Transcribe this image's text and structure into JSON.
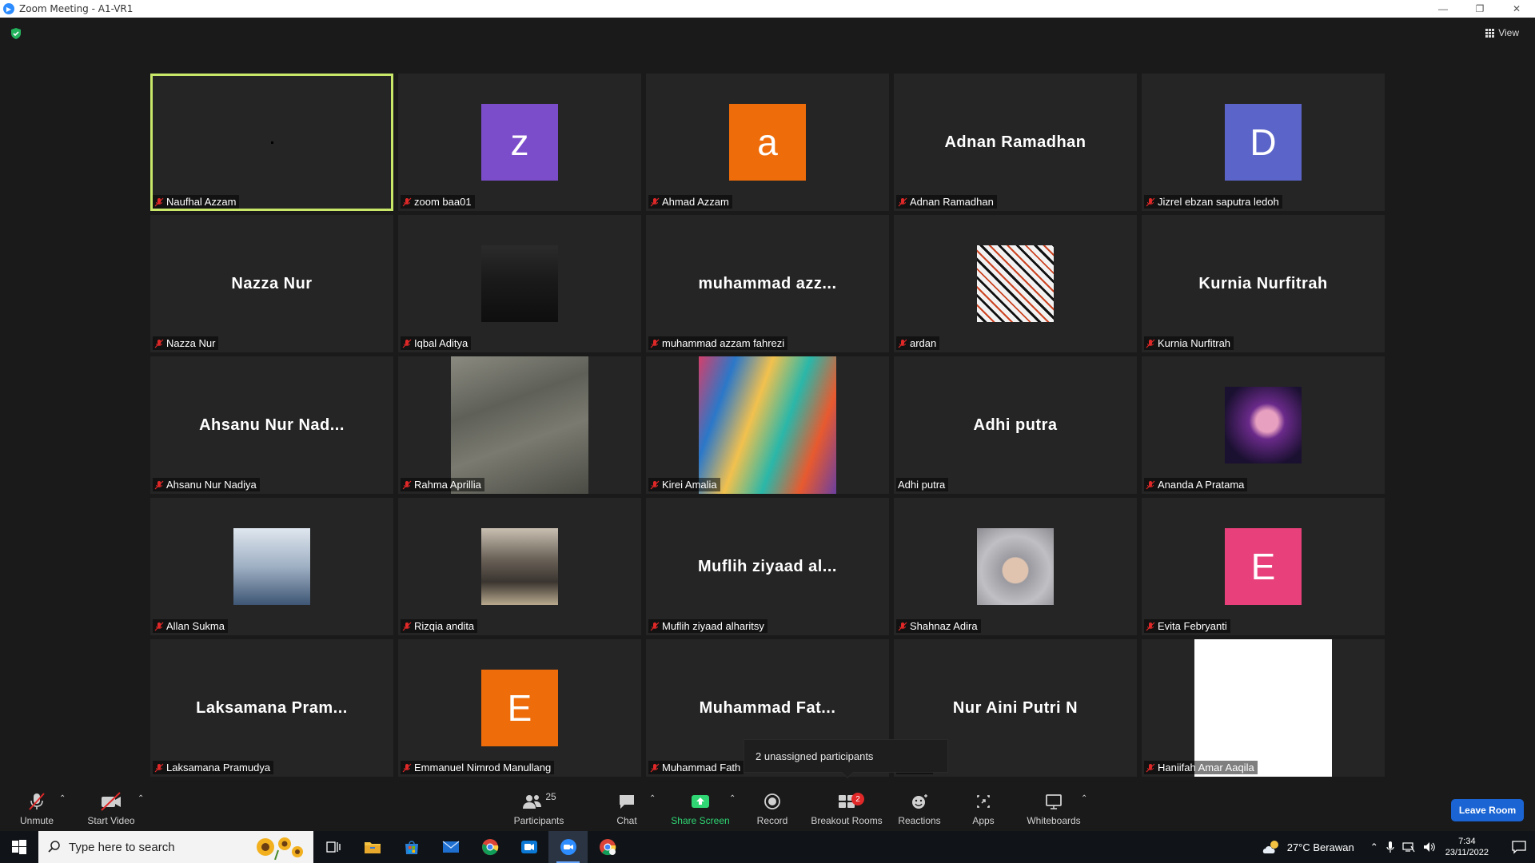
{
  "window": {
    "title": "Zoom Meeting - A1-VR1",
    "view_label": "View"
  },
  "colors": {
    "active_speaker_border": "#c9e86a",
    "leave_button": "#1a64d4",
    "share_screen": "#2fd673",
    "badge": "#e02828"
  },
  "participants": [
    {
      "name": "Naufhal Azzam",
      "tile": "blank",
      "muted": true,
      "active": true
    },
    {
      "name": "zoom baa01",
      "tile": "avatar",
      "initial": "z",
      "color": "#7c4dca",
      "muted": true
    },
    {
      "name": "Ahmad Azzam",
      "tile": "avatar",
      "initial": "a",
      "color": "#ef6c0a",
      "muted": true
    },
    {
      "name": "Adnan Ramadhan",
      "tile": "name",
      "display": "Adnan Ramadhan",
      "muted": true
    },
    {
      "name": "Jizrel ebzan saputra ledoh",
      "tile": "avatar",
      "initial": "D",
      "color": "#5b64c8",
      "muted": true
    },
    {
      "name": "Nazza Nur",
      "tile": "name",
      "display": "Nazza Nur",
      "muted": true
    },
    {
      "name": "Iqbal Aditya",
      "tile": "photo",
      "photo": "person-mask",
      "muted": true
    },
    {
      "name": "muhammad azzam fahrezi",
      "tile": "name",
      "display": "muhammad azz...",
      "muted": true
    },
    {
      "name": "ardan",
      "tile": "photo",
      "photo": "lips-pattern",
      "muted": true
    },
    {
      "name": "Kurnia Nurfitrah",
      "tile": "name",
      "display": "Kurnia Nurfitrah",
      "muted": true
    },
    {
      "name": "Ahsanu Nur Nadiya",
      "tile": "name",
      "display": "Ahsanu Nur Nad...",
      "muted": true
    },
    {
      "name": "Rahma Aprillia",
      "tile": "video",
      "photo": "city-buildings",
      "muted": true
    },
    {
      "name": "Kirei Amalia",
      "tile": "video",
      "photo": "colorful-wall",
      "muted": true
    },
    {
      "name": "Adhi putra",
      "tile": "name",
      "display": "Adhi putra",
      "muted": false
    },
    {
      "name": "Ananda A Pratama",
      "tile": "photo",
      "photo": "neon-portrait",
      "muted": true
    },
    {
      "name": "Allan Sukma",
      "tile": "photo",
      "photo": "ice-chair",
      "muted": true
    },
    {
      "name": "Rizqia andita",
      "tile": "photo",
      "photo": "shop-front",
      "muted": true
    },
    {
      "name": "Muflih ziyaad alharitsy",
      "tile": "name",
      "display": "Muflih ziyaad al...",
      "muted": true
    },
    {
      "name": "Shahnaz Adira",
      "tile": "photo",
      "photo": "hoodie-girl",
      "muted": true
    },
    {
      "name": "Evita Febryanti",
      "tile": "avatar",
      "initial": "E",
      "color": "#e8407a",
      "muted": true
    },
    {
      "name": "Laksamana Pramudya",
      "tile": "name",
      "display": "Laksamana Pram...",
      "muted": true
    },
    {
      "name": "Emmanuel Nimrod Manullang",
      "tile": "avatar",
      "initial": "E",
      "color": "#ef6c0a",
      "muted": true
    },
    {
      "name": "Muhammad Fath",
      "tile": "name",
      "display": "Muhammad Fat...",
      "muted": true
    },
    {
      "name": "Putri N",
      "tile": "name",
      "display": "Nur Aini Putri N",
      "muted": false
    },
    {
      "name": "Haniifah Amar Aaqila",
      "tile": "video",
      "photo": "white-frame",
      "muted": true
    }
  ],
  "popup": {
    "text": "2 unassigned participants"
  },
  "toolbar": {
    "unmute": "Unmute",
    "start_video": "Start Video",
    "participants": "Participants",
    "participants_count": "25",
    "chat": "Chat",
    "share_screen": "Share Screen",
    "record": "Record",
    "breakout_rooms": "Breakout Rooms",
    "breakout_badge": "2",
    "reactions": "Reactions",
    "apps": "Apps",
    "whiteboards": "Whiteboards",
    "leave_room": "Leave Room"
  },
  "taskbar": {
    "search_placeholder": "Type here to search",
    "weather": "27°C  Berawan",
    "time": "7:34",
    "date": "23/11/2022"
  }
}
